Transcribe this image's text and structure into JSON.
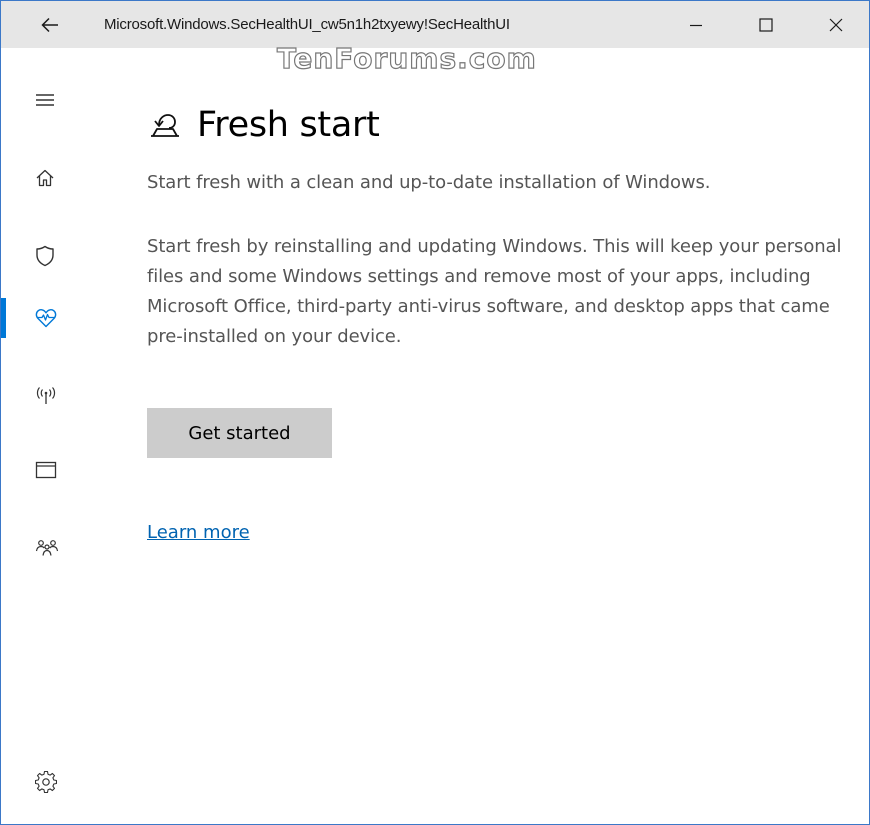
{
  "window": {
    "title": "Microsoft.Windows.SecHealthUI_cw5n1h2txyewy!SecHealthUI",
    "watermark": "TenForums.com"
  },
  "titlebar": {
    "back_icon": "arrow-left-icon",
    "minimize_icon": "minimize-icon",
    "maximize_icon": "maximize-icon",
    "close_icon": "close-icon"
  },
  "sidebar": {
    "items": [
      {
        "icon": "hamburger-menu-icon"
      },
      {
        "icon": "home-icon"
      },
      {
        "icon": "shield-icon"
      },
      {
        "icon": "heart-health-icon",
        "selected": true
      },
      {
        "icon": "wireless-network-icon"
      },
      {
        "icon": "app-browser-icon"
      },
      {
        "icon": "family-icon"
      }
    ],
    "settings_icon": "gear-icon",
    "accent_color": "#0078d7"
  },
  "main": {
    "title_icon": "fresh-start-icon",
    "title": "Fresh start",
    "subtitle": "Start fresh with a clean and up-to-date installation of Windows.",
    "description": "Start fresh by reinstalling and updating Windows. This will keep your personal files and some Windows settings and remove most of your apps, including Microsoft Office, third-party anti-virus software, and desktop apps that came pre-installed on your device.",
    "get_started_label": "Get started",
    "learn_more_label": "Learn more",
    "link_color": "#0063b1"
  }
}
